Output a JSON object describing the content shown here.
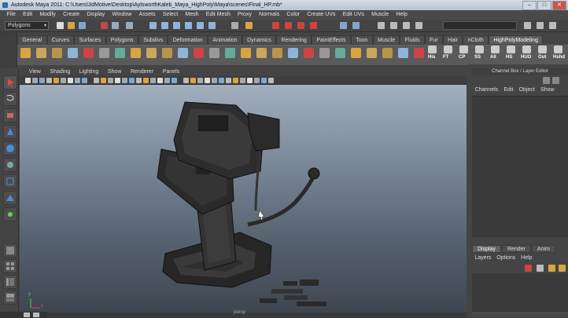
{
  "window": {
    "title": "Autodesk Maya 2011: C:\\Users\\3dMotive\\Desktop\\AylsworthKaleb_Maya_HighPoly\\Maya\\scenes\\Final_HP.mb*",
    "min": "–",
    "max": "□",
    "close": "✕"
  },
  "menubar": [
    "File",
    "Edit",
    "Modify",
    "Create",
    "Display",
    "Window",
    "Assets",
    "Select",
    "Mesh",
    "Edit Mesh",
    "Proxy",
    "Normals",
    "Color",
    "Create UVs",
    "Edit UVs",
    "Muscle",
    "Help"
  ],
  "statusline": {
    "mode": "Polygons",
    "mode_arrow": "▾"
  },
  "shelf": {
    "tabs": [
      "General",
      "Curves",
      "Surfaces",
      "Polygons",
      "Subdivs",
      "Deformation",
      "Animation",
      "Dynamics",
      "Rendering",
      "PaintEffects",
      "Toon",
      "Muscle",
      "Fluids",
      "Fur",
      "Hair",
      "nCloth",
      "HighPolyModeling"
    ],
    "active_tab": "HighPolyModeling",
    "labels": [
      "His",
      "FT",
      "CP",
      "SS",
      "All",
      "HS",
      "HUO",
      "Out",
      "Hshd"
    ]
  },
  "panel": {
    "menu": [
      "View",
      "Shading",
      "Lighting",
      "Show",
      "Renderer",
      "Panels"
    ],
    "hud_label": "persp"
  },
  "viewport": {
    "axis": {
      "x": "x",
      "y": "y"
    }
  },
  "channel_box": {
    "title": "Channel Box / Layer Editor",
    "menu": [
      "Channels",
      "Edit",
      "Object",
      "Show"
    ]
  },
  "layer_editor": {
    "tabs": [
      "Display",
      "Render",
      "Anim"
    ],
    "active_tab": "Display",
    "menu": [
      "Layers",
      "Options",
      "Help"
    ]
  },
  "colors": {
    "accent": "#c9584a",
    "viewport_top": "#a2afbe",
    "viewport_bottom": "#3e4650",
    "shelf_active": "#5c5c5c"
  }
}
